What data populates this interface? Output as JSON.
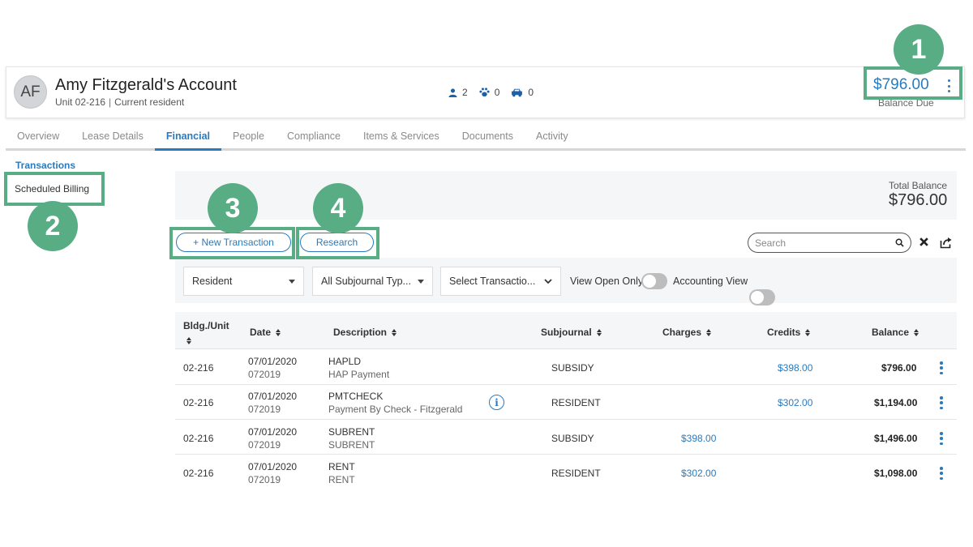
{
  "account": {
    "initials": "AF",
    "title": "Amy Fitzgerald's Account",
    "unit": "Unit 02-216",
    "status": "Current resident",
    "occupants": "2",
    "pets": "0",
    "vehicles": "0",
    "balance": "$796.00",
    "balance_label": "Balance Due"
  },
  "tabs": [
    "Overview",
    "Lease Details",
    "Financial",
    "People",
    "Compliance",
    "Items & Services",
    "Documents",
    "Activity"
  ],
  "active_tab": "Financial",
  "side_menu": {
    "transactions": "Transactions",
    "scheduled_billing": "Scheduled Billing"
  },
  "summary": {
    "total_label": "Total Balance",
    "total_value": "$796.00"
  },
  "actions": {
    "new_transaction": "+ New Transaction",
    "research": "Research",
    "search_placeholder": "Search"
  },
  "filters": {
    "resident": "Resident",
    "subjournal": "All Subjournal Typ...",
    "transaction": "Select Transactio...",
    "view_open_only": "View Open Only",
    "accounting_view": "Accounting View",
    "view_open_only_on": false,
    "accounting_view_on": false
  },
  "table": {
    "headers": [
      "Bldg./Unit",
      "Date",
      "Description",
      "Subjournal",
      "Charges",
      "Credits",
      "Balance"
    ],
    "rows": [
      {
        "unit": "02-216",
        "date": "07/01/2020",
        "batch": "072019",
        "code": "HAPLD",
        "desc": "HAP Payment",
        "subjournal": "SUBSIDY",
        "charges": "",
        "credits": "$398.00",
        "balance": "$796.00",
        "info": false
      },
      {
        "unit": "02-216",
        "date": "07/01/2020",
        "batch": "072019",
        "code": "PMTCHECK",
        "desc": "Payment By Check - Fitzgerald",
        "subjournal": "RESIDENT",
        "charges": "",
        "credits": "$302.00",
        "balance": "$1,194.00",
        "info": true
      },
      {
        "unit": "02-216",
        "date": "07/01/2020",
        "batch": "072019",
        "code": "SUBRENT",
        "desc": "SUBRENT",
        "subjournal": "SUBSIDY",
        "charges": "$398.00",
        "credits": "",
        "balance": "$1,496.00",
        "info": false
      },
      {
        "unit": "02-216",
        "date": "07/01/2020",
        "batch": "072019",
        "code": "RENT",
        "desc": "RENT",
        "subjournal": "RESIDENT",
        "charges": "$302.00",
        "credits": "",
        "balance": "$1,098.00",
        "info": false
      }
    ]
  },
  "callouts": [
    "1",
    "2",
    "3",
    "4"
  ],
  "colors": {
    "accent": "#2a7abf",
    "callout": "#59ad84",
    "band": "#f5f6f7"
  }
}
